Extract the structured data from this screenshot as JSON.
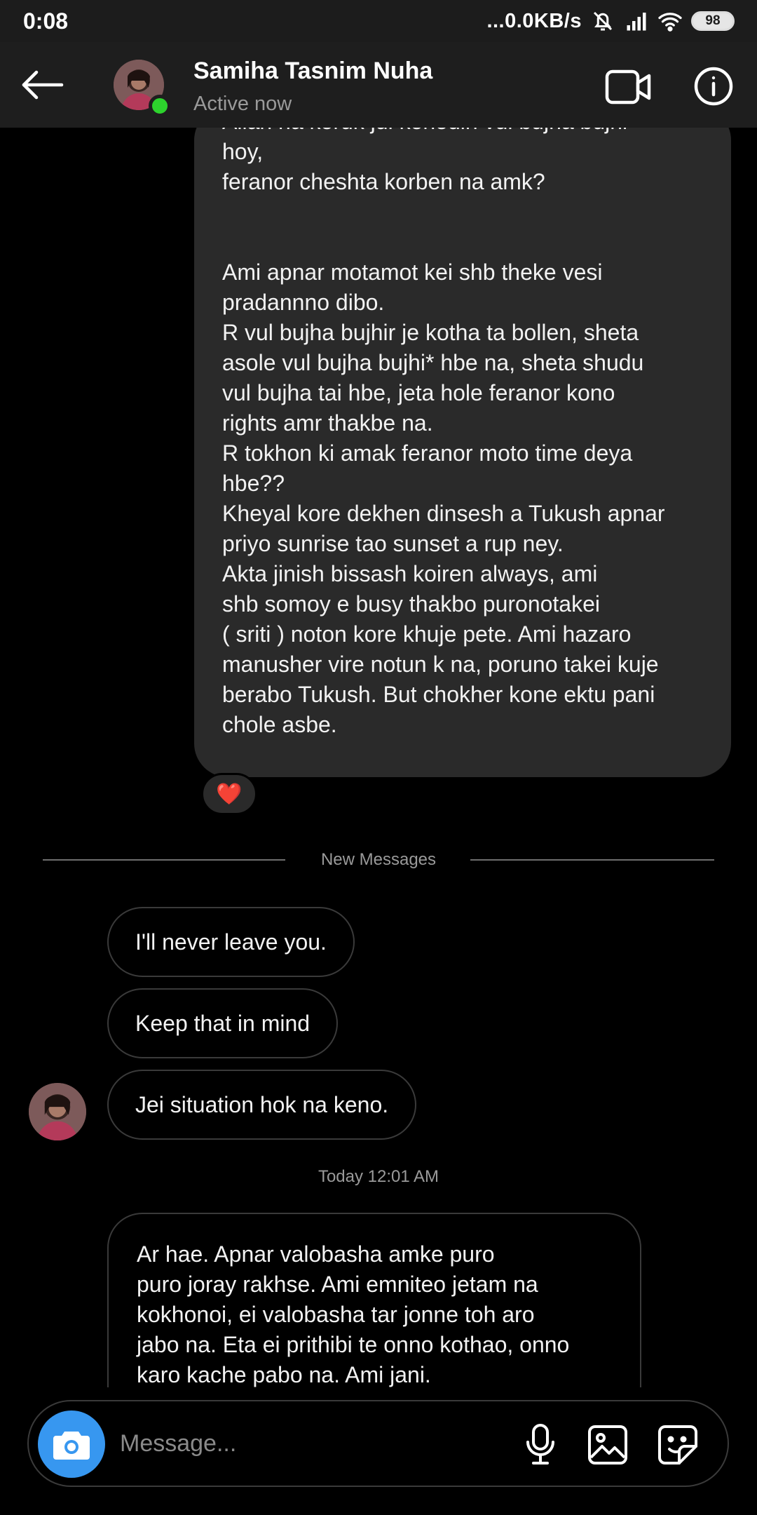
{
  "status_bar": {
    "time": "0:08",
    "net_speed": "...0.0KB/s",
    "battery": "98",
    "icons": [
      "mute-icon",
      "signal-icon",
      "wifi-icon",
      "battery-icon"
    ]
  },
  "header": {
    "contact_name": "Samiha Tasnim Nuha",
    "contact_status": "Active now",
    "icons": [
      "back-arrow-icon",
      "video-call-icon",
      "info-icon"
    ],
    "online_color": "#2dd32d"
  },
  "messages": {
    "sent_long": {
      "lines": [
        "Allah na koruk jdi konodin vul bujha bujhi",
        "hoy,",
        "feranor cheshta korben na amk?",
        "",
        "",
        "Ami apnar motamot kei shb theke vesi",
        "pradannno dibo.",
        "R vul bujha bujhir je kotha ta bollen, sheta",
        "asole vul bujha bujhi* hbe na, sheta shudu",
        "vul bujha tai hbe, jeta hole feranor kono",
        "rights amr thakbe na.",
        "R tokhon ki amak feranor moto time deya",
        "hbe??",
        "Kheyal kore dekhen dinsesh a Tukush apnar",
        "priyo sunrise tao sunset a rup ney.",
        "Akta jinish bissash koiren always, ami",
        "shb somoy e busy thakbo puronotakei",
        "( sriti ) noton kore khuje pete. Ami hazaro",
        "manusher vire notun k na, poruno takei kuje",
        "berabo Tukush. But chokher kone ektu pani",
        "chole asbe."
      ],
      "reaction": "❤️"
    },
    "divider_label": "New Messages",
    "received": [
      "I'll never leave you.",
      "Keep that in mind",
      "Jei situation hok na keno."
    ],
    "timestamp": "Today 12:01 AM",
    "received_long": {
      "lines": [
        "Ar hae. Apnar valobasha amke puro",
        "puro joray rakhse. Ami emniteo jetam na",
        "kokhonoi, ei valobasha tar jonne toh aro",
        "jabo na. Eta ei prithibi te onno kothao, onno",
        "karo kache pabo na. Ami jani."
      ]
    }
  },
  "composer": {
    "placeholder": "Message...",
    "value": "",
    "icons": [
      "camera-icon",
      "microphone-icon",
      "gallery-icon",
      "sticker-icon"
    ],
    "camera_color": "#3797f0"
  }
}
